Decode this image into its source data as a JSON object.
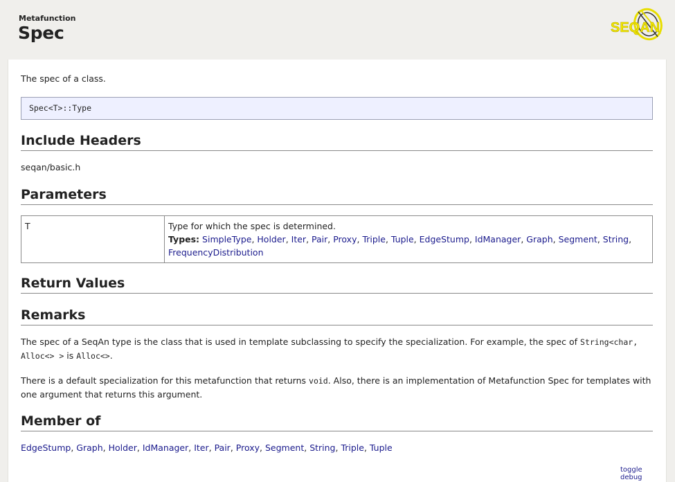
{
  "header": {
    "kind": "Metafunction",
    "title": "Spec",
    "logo_text": "SEQAN"
  },
  "summary": "The spec of a class.",
  "signature": "Spec<T>::Type",
  "sections": {
    "include_headers": "Include Headers",
    "parameters": "Parameters",
    "return_values": "Return Values",
    "remarks": "Remarks",
    "member_of": "Member of"
  },
  "include_header": "seqan/basic.h",
  "parameters": [
    {
      "name": "T",
      "description": "Type for which the spec is determined.",
      "types_label": "Types:",
      "types": [
        "SimpleType",
        "Holder",
        "Iter",
        "Pair",
        "Proxy",
        "Triple",
        "Tuple",
        "EdgeStump",
        "IdManager",
        "Graph",
        "Segment",
        "String",
        "FrequencyDistribution"
      ]
    }
  ],
  "remarks": {
    "p1_a": "The spec of a SeqAn type is the class that is used in template subclassing to specify the specialization. For example, the spec of ",
    "p1_code1": "String<char, Alloc<> >",
    "p1_b": " is ",
    "p1_code2": "Alloc<>",
    "p1_c": ".",
    "p2_a": "There is a default specialization for this metafunction that returns ",
    "p2_code": "void",
    "p2_b": ". Also, there is an implementation of Metafunction Spec for templates with one argument that returns this argument."
  },
  "member_of": [
    "EdgeStump",
    "Graph",
    "Holder",
    "IdManager",
    "Iter",
    "Pair",
    "Proxy",
    "Segment",
    "String",
    "Triple",
    "Tuple"
  ],
  "footer": {
    "toggle_debug": "toggle debug"
  },
  "colors": {
    "background": "#f0efec",
    "link": "#1a1a8c",
    "signature_bg": "#eef0ff",
    "logo_yellow": "#f2e600"
  }
}
